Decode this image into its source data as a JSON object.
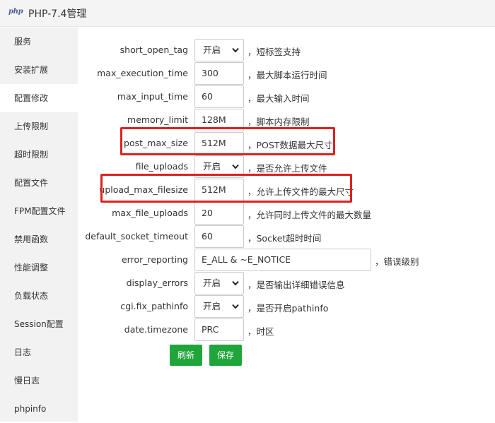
{
  "window": {
    "logo_text": "php",
    "title": "PHP-7.4管理"
  },
  "sidebar": {
    "items": [
      {
        "label": "服务"
      },
      {
        "label": "安装扩展"
      },
      {
        "label": "配置修改",
        "active": true
      },
      {
        "label": "上传限制"
      },
      {
        "label": "超时限制"
      },
      {
        "label": "配置文件"
      },
      {
        "label": "FPM配置文件"
      },
      {
        "label": "禁用函数"
      },
      {
        "label": "性能调整"
      },
      {
        "label": "负载状态"
      },
      {
        "label": "Session配置"
      },
      {
        "label": "日志"
      },
      {
        "label": "慢日志"
      },
      {
        "label": "phpinfo"
      }
    ]
  },
  "settings": {
    "rows": [
      {
        "key": "short_open_tag",
        "type": "select",
        "value": "开启",
        "desc": "，短标签支持"
      },
      {
        "key": "max_execution_time",
        "type": "input",
        "value": "300",
        "desc": "，最大脚本运行时间"
      },
      {
        "key": "max_input_time",
        "type": "input",
        "value": "60",
        "desc": "，最大输入时间"
      },
      {
        "key": "memory_limit",
        "type": "input",
        "value": "128M",
        "desc": "，脚本内存限制"
      },
      {
        "key": "post_max_size",
        "type": "input",
        "value": "512M",
        "desc": "，POST数据最大尺寸",
        "highlighted": true
      },
      {
        "key": "file_uploads",
        "type": "select",
        "value": "开启",
        "desc": "，是否允许上传文件"
      },
      {
        "key": "upload_max_filesize",
        "type": "input",
        "value": "512M",
        "desc": "，允许上传文件的最大尺寸",
        "highlighted": true
      },
      {
        "key": "max_file_uploads",
        "type": "input",
        "value": "20",
        "desc": "，允许同时上传文件的最大数量"
      },
      {
        "key": "default_socket_timeout",
        "type": "input",
        "value": "60",
        "desc": "，Socket超时时间"
      },
      {
        "key": "error_reporting",
        "type": "input-wide",
        "value": "E_ALL & ~E_NOTICE",
        "desc": "，错误级别"
      },
      {
        "key": "display_errors",
        "type": "select",
        "value": "开启",
        "desc": "，是否输出详细错误信息"
      },
      {
        "key": "cgi.fix_pathinfo",
        "type": "select",
        "value": "开启",
        "desc": "，是否开启pathinfo"
      },
      {
        "key": "date.timezone",
        "type": "input",
        "value": "PRC",
        "desc": "，时区"
      }
    ],
    "select_icon": "chevron-down-icon"
  },
  "buttons": {
    "refresh_label": "刷新",
    "save_label": "保存"
  },
  "colors": {
    "accent": "#20a53a",
    "highlight": "#e02020",
    "sidebar_bg": "#f2f2f2",
    "titlebar_bg": "#f4f4f4"
  }
}
